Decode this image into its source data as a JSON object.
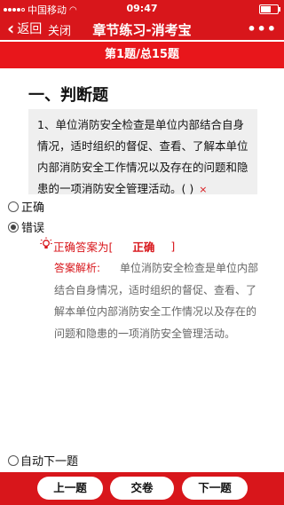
{
  "status": {
    "carrier": "中国移动",
    "time": "09:47",
    "battery_level": 0.7
  },
  "nav": {
    "back_label": "返回",
    "close_label": "关闭",
    "title": "章节练习-消考宝",
    "more_label": "•••"
  },
  "progress": {
    "text": "第1题/总15题"
  },
  "section": {
    "title": "一、判断题"
  },
  "question": {
    "text": "1、单位消防安全检查是单位内部结合自身情况，适时组织的督促、查看、了解本单位内部消防安全工作情况以及存在的问题和隐患的一项消防安全管理活动。( )",
    "result_mark": "×"
  },
  "options": [
    {
      "label": "正确",
      "checked": false
    },
    {
      "label": "错误",
      "checked": true
    }
  ],
  "answer": {
    "label": "正确答案为[",
    "value": "正确",
    "close": "]"
  },
  "analysis": {
    "label": "答案解析:",
    "text": "单位消防安全检查是单位内部结合自身情况，适时组织的督促、查看、了解本单位内部消防安全工作情况以及存在的问题和隐患的一项消防安全管理活动。"
  },
  "auto_next": {
    "label": "自动下一题",
    "checked": false
  },
  "buttons": {
    "prev": "上一题",
    "submit": "交卷",
    "next": "下一题"
  },
  "colors": {
    "brand_red": "#d8161b",
    "question_bg": "#efefef"
  }
}
